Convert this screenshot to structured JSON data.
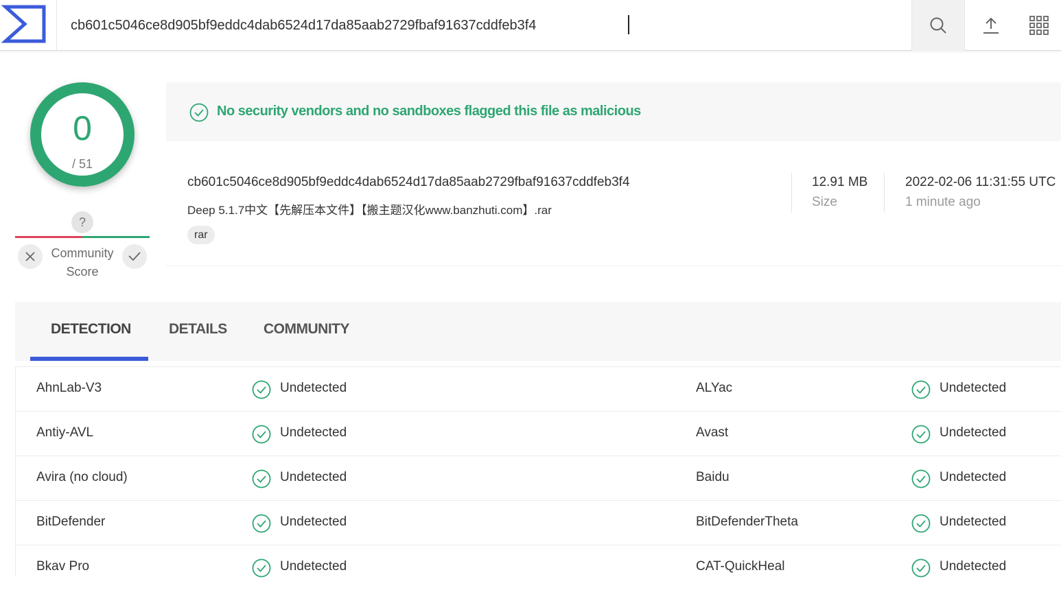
{
  "search": {
    "value": "cb601c5046ce8d905bf9eddc4dab6524d17da85aab2729fbaf91637cddfeb3f4"
  },
  "icons": {
    "logo": "virustotal-logo-icon",
    "search": "search-icon",
    "upload": "upload-icon",
    "apps": "apps-grid-icon"
  },
  "score": {
    "detections": "0",
    "total": "/ 51"
  },
  "community": {
    "question": "?",
    "label": "Community Score"
  },
  "banner": {
    "text": "No security vendors and no sandboxes flagged this file as malicious"
  },
  "file": {
    "hash": "cb601c5046ce8d905bf9eddc4dab6524d17da85aab2729fbaf91637cddfeb3f4",
    "name": "Deep 5.1.7中文【先解压本文件】【搬主题汉化www.banzhuti.com】.rar",
    "tag": "rar",
    "size_value": "12.91 MB",
    "size_label": "Size",
    "date_value": "2022-02-06 11:31:55 UTC",
    "date_label": "1 minute ago"
  },
  "tabs": [
    "DETECTION",
    "DETAILS",
    "COMMUNITY"
  ],
  "detections": [
    {
      "left_engine": "AhnLab-V3",
      "left_status": "Undetected",
      "right_engine": "ALYac",
      "right_status": "Undetected"
    },
    {
      "left_engine": "Antiy-AVL",
      "left_status": "Undetected",
      "right_engine": "Avast",
      "right_status": "Undetected"
    },
    {
      "left_engine": "Avira (no cloud)",
      "left_status": "Undetected",
      "right_engine": "Baidu",
      "right_status": "Undetected"
    },
    {
      "left_engine": "BitDefender",
      "left_status": "Undetected",
      "right_engine": "BitDefenderTheta",
      "right_status": "Undetected"
    },
    {
      "left_engine": "Bkav Pro",
      "left_status": "Undetected",
      "right_engine": "CAT-QuickHeal",
      "right_status": "Undetected"
    }
  ],
  "colors": {
    "brand": "#3b5bdb",
    "clean": "#2ea672",
    "malicious": "#e0435b"
  }
}
